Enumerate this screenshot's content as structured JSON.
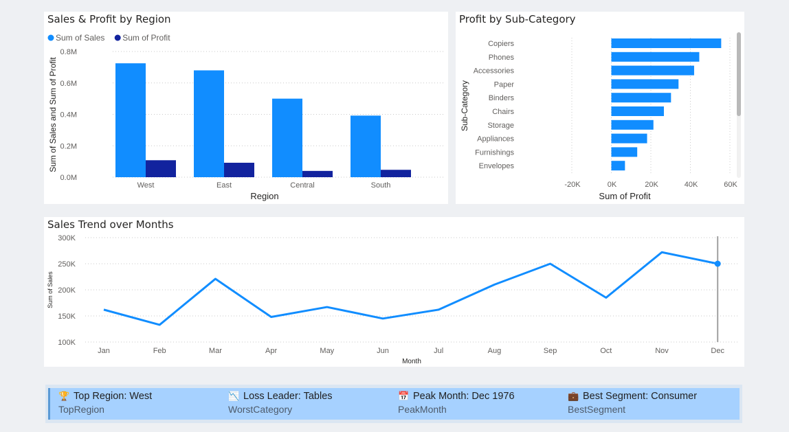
{
  "chart_data": [
    {
      "type": "bar",
      "title": "Sales & Profit by Region",
      "xlabel": "Region",
      "ylabel": "Sum of Sales and Sum of Profit",
      "categories": [
        "West",
        "East",
        "Central",
        "South"
      ],
      "series": [
        {
          "name": "Sum of Sales",
          "values": [
            725000,
            680000,
            500000,
            392000
          ],
          "color": "#118dff"
        },
        {
          "name": "Sum of Profit",
          "values": [
            108000,
            92000,
            40000,
            47000
          ],
          "color": "#12239e"
        }
      ],
      "ylim": [
        0,
        800000
      ],
      "ticks": [
        {
          "value": 0,
          "label": "0.0M"
        },
        {
          "value": 200000,
          "label": "0.2M"
        },
        {
          "value": 400000,
          "label": "0.4M"
        },
        {
          "value": 600000,
          "label": "0.6M"
        },
        {
          "value": 800000,
          "label": "0.8M"
        }
      ],
      "legend": "top-left",
      "grid": true
    },
    {
      "type": "bar",
      "orientation": "horizontal",
      "title": "Profit by Sub-Category",
      "xlabel": "Sum of Profit",
      "ylabel": "Sub-Category",
      "categories": [
        "Copiers",
        "Phones",
        "Accessories",
        "Paper",
        "Binders",
        "Chairs",
        "Storage",
        "Appliances",
        "Furnishings",
        "Envelopes"
      ],
      "values": [
        55600,
        44500,
        41900,
        34000,
        30200,
        26600,
        21300,
        18100,
        13100,
        6900
      ],
      "color": "#118dff",
      "xlim": [
        -20000,
        60000
      ],
      "ticks": [
        {
          "value": -20000,
          "label": "-20K"
        },
        {
          "value": 0,
          "label": "0K"
        },
        {
          "value": 20000,
          "label": "20K"
        },
        {
          "value": 40000,
          "label": "40K"
        },
        {
          "value": 60000,
          "label": "60K"
        }
      ],
      "grid": true
    },
    {
      "type": "line",
      "title": "Sales Trend over Months",
      "xlabel": "Month",
      "ylabel": "Sum of Sales",
      "x": [
        "Jan",
        "Feb",
        "Mar",
        "Apr",
        "May",
        "Jun",
        "Jul",
        "Aug",
        "Sep",
        "Oct",
        "Nov",
        "Dec"
      ],
      "values": [
        162000,
        133000,
        221000,
        148000,
        167000,
        145000,
        162000,
        210000,
        250000,
        185000,
        272000,
        250000
      ],
      "color": "#118dff",
      "ylim": [
        100000,
        300000
      ],
      "ticks": [
        {
          "value": 100000,
          "label": "100K"
        },
        {
          "value": 150000,
          "label": "150K"
        },
        {
          "value": 200000,
          "label": "200K"
        },
        {
          "value": 250000,
          "label": "250K"
        },
        {
          "value": 300000,
          "label": "300K"
        }
      ],
      "highlight": "Dec",
      "grid": true
    }
  ],
  "kpis": [
    {
      "icon": "trophy-icon",
      "glyph": "🏆",
      "title": "Top Region: West",
      "subtitle": "TopRegion"
    },
    {
      "icon": "chart-down-icon",
      "glyph": "📉",
      "title": "Loss Leader: Tables",
      "subtitle": "WorstCategory"
    },
    {
      "icon": "calendar-icon",
      "glyph": "📅",
      "title": "Peak Month: Dec 1976",
      "subtitle": "PeakMonth"
    },
    {
      "icon": "briefcase-icon",
      "glyph": "💼",
      "title": "Best Segment: Consumer",
      "subtitle": "BestSegment"
    }
  ]
}
